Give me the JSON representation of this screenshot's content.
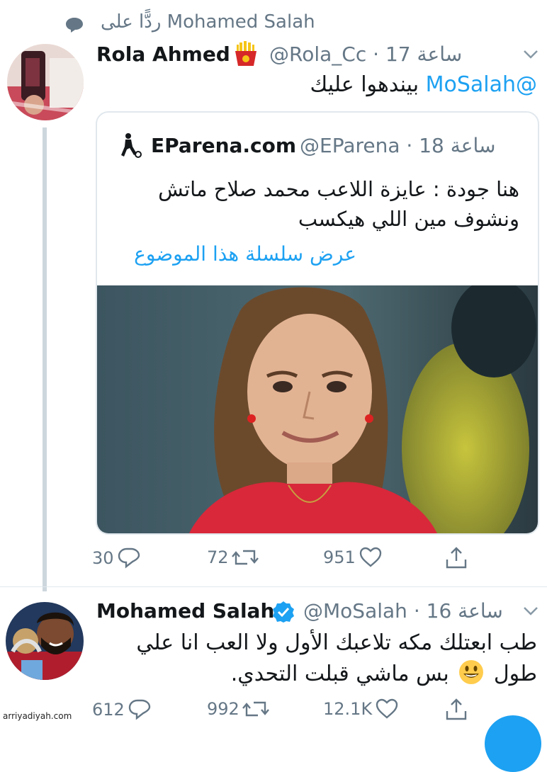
{
  "reply_context": {
    "text": "ردًّا على Mohamed Salah"
  },
  "tweet1": {
    "name": "Rola Ahmed",
    "handle": "@Rola_Cc",
    "time": "17 ساعة",
    "separator": "·",
    "mention": "@MoSalah",
    "text": "بيندهوا عليك",
    "quote": {
      "name": "EParena.com",
      "handle": "@EParena",
      "time": "18 ساعة",
      "separator": "·",
      "text_line1": "هنا جودة : عايزة اللاعب محمد صلاح ماتش",
      "text_line2": "ونشوف مين اللي هيكسب",
      "thread_link": "عرض سلسلة هذا الموضوع"
    },
    "actions": {
      "replies": "30",
      "retweets": "72",
      "likes": "951"
    }
  },
  "tweet2": {
    "name": "Mohamed Salah",
    "handle": "@MoSalah",
    "time": "16 ساعة",
    "separator": "·",
    "text_line1": "طب ابعتلك مكه تلاعبك الأول ولا العب انا علي",
    "text_line2_a": "طول",
    "text_line2_b": "بس ماشي قبلت التحدي.",
    "actions": {
      "replies": "612",
      "retweets": "992",
      "likes": "12.1K"
    }
  },
  "watermark": "arriyadiyah.com",
  "colors": {
    "link_blue": "#1da1f2",
    "secondary_grey": "#657786",
    "verified_blue": "#1da1f2",
    "border": "#e1e8ed"
  },
  "icons": [
    "reply-context-bubble-icon",
    "fries-emoji-icon",
    "verified-badge-icon",
    "smiley-emoji-icon",
    "reply-icon",
    "retweet-icon",
    "like-icon",
    "share-icon",
    "chevron-down-icon",
    "football-player-logo-icon"
  ]
}
